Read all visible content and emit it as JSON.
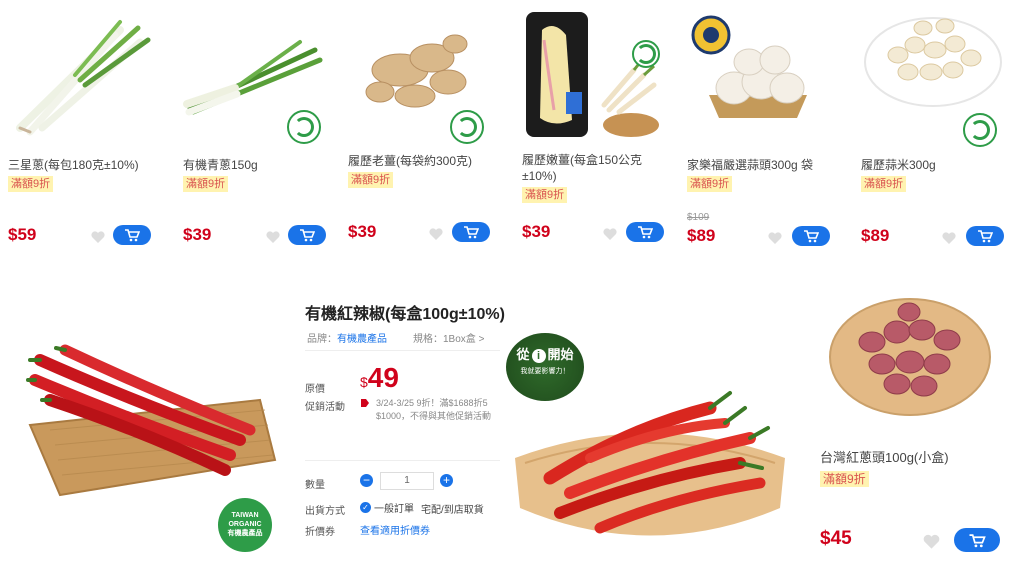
{
  "products_top": [
    {
      "name": "三星蔥(每包180克±10%)",
      "badge": "滿額9折",
      "price": "$59",
      "old_price": ""
    },
    {
      "name": "有機青蔥150g",
      "badge": "滿額9折",
      "price": "$39",
      "old_price": ""
    },
    {
      "name": "履歷老薑(每袋約300克)",
      "badge": "滿額9折",
      "price": "$39",
      "old_price": ""
    },
    {
      "name": "履歷嫩薑(每盒150公克±10%)",
      "badge": "滿額9折",
      "price": "$39",
      "old_price": ""
    },
    {
      "name": "家樂福嚴選蒜頭300g 袋",
      "badge": "滿額9折",
      "price": "$89",
      "old_price": "$109"
    },
    {
      "name": "履歷蒜米300g",
      "badge": "滿額9折",
      "price": "$89",
      "old_price": ""
    }
  ],
  "detail": {
    "title": "有機紅辣椒(每盒100g±10%)",
    "brand_label": "品牌：",
    "brand": "有機農產品",
    "spec_label": "規格：",
    "spec": "1Box盒 >",
    "price_label": "原價",
    "price": "49",
    "currency": "$",
    "promo_label": "促銷活動",
    "promo_text_1": "3/24-3/25 9折！滿$1688折5",
    "promo_text_2": "$1000，不得與其他促銷活動",
    "qty_label": "數量",
    "qty_value": "1",
    "ship_label": "出貨方式",
    "ship_option_1": "一般訂單",
    "ship_option_2": "宅配/到店取貨",
    "coupon_label": "折價券",
    "coupon_link": "查看適用折價券",
    "banner_1": "從",
    "banner_2": "i",
    "banner_3": "開始",
    "banner_4": "我就要影響力！",
    "organic_logo_1": "TAIWAN",
    "organic_logo_2": "ORGANIC",
    "organic_logo_3": "有機農產品"
  },
  "side_product": {
    "name": "台灣紅蔥頭100g(小盒)",
    "badge": "滿額9折",
    "price": "$45"
  },
  "colors": {
    "accent": "#1a73e8",
    "price": "#d0021b",
    "badge_bg": "#fff3b0",
    "organic": "#2e9c48"
  }
}
